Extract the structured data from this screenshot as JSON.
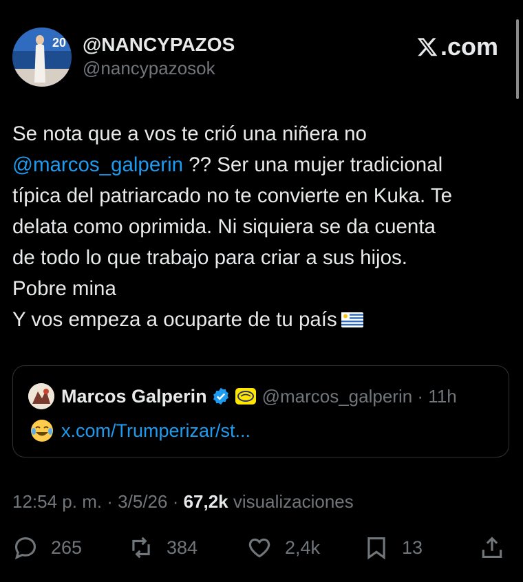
{
  "author": {
    "display_name": "@NANCYPAZOS",
    "handle": "@nancypazosok",
    "avatar_text": "20"
  },
  "brand": {
    "label": ".com"
  },
  "tweet": {
    "line1": "Se nota que a vos te crió una niñera no",
    "mention": "@marcos_galperin",
    "line2_rest": " ?? Ser una mujer tradicional",
    "line3": "típica del patriarcado no te convierte en Kuka. Te",
    "line4": "delata como oprimida. Ni siquiera se da cuenta",
    "line5": "de todo lo que trabajo para criar a sus hijos.",
    "line6": "Pobre mina",
    "line7": "Y vos empeza a ocuparte de tu país",
    "flag": "uruguay-flag"
  },
  "quote": {
    "name": "Marcos Galperin",
    "meta": "@marcos_galperin · 11h",
    "link": "x.com/Trumperizar/st..."
  },
  "meta": {
    "time": "12:54 p. m. · 3/5/26 · ",
    "views_count": "67,2k",
    "views_label": " visualizaciones"
  },
  "actions": {
    "replies": "265",
    "reposts": "384",
    "likes": "2,4k",
    "bookmarks": "13"
  },
  "colors": {
    "background": "#000000",
    "text": "#e7e9ea",
    "secondary": "#71767b",
    "link": "#1d9bf0",
    "border": "#2f3336"
  }
}
